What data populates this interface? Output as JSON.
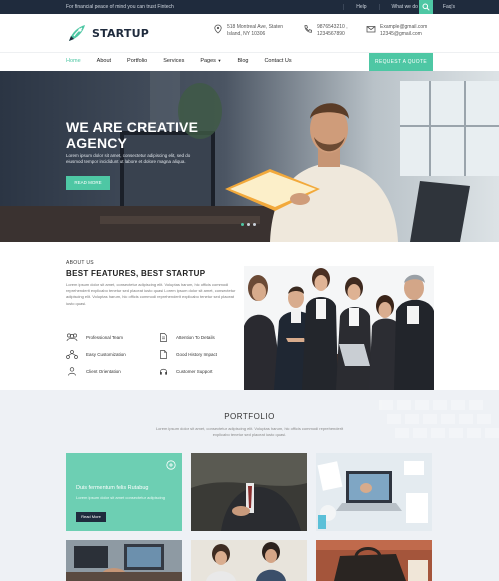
{
  "topbar": {
    "tagline": "For financial peace of mind you can trust Fintech",
    "links": [
      "Help",
      "What we do",
      "Faq's"
    ]
  },
  "brand": {
    "name": "STARTUP",
    "accent": "#4ec7a4",
    "dark": "#1f2b3d"
  },
  "contact": {
    "address_line1": "518 Montreal Ave, Staten",
    "address_line2": "Island, NY 10306",
    "phone_line1": "9876543210 ,",
    "phone_line2": "1234567890",
    "email_line1": "Example@gmail.com",
    "email_line2": "12345@gmail.com"
  },
  "nav": {
    "items": [
      "Home",
      "About",
      "Portfolio",
      "Services",
      "Pages",
      "Blog",
      "Contact Us"
    ],
    "active": "Home",
    "cta": "REQUEST A QUOTE"
  },
  "hero": {
    "title_line1": "WE ARE CREATIVE",
    "title_line2": "AGENCY",
    "text": "Lorem ipsum dolor sit amet, consectetur adipiscing elit, sed do eiusmod tempor incididunt ut labore et dolore magna aliqua.",
    "button": "READ MORE"
  },
  "features": {
    "kicker": "ABOUT US",
    "title": "BEST FEATURES, BEST STARTUP",
    "text": "Lorem ipsum dolor sit amet, consectetur adipiscing elit. Voluptas harum, hic officis commodi reprehenderit explicabo tenetur sed placeat iusto quasi Lorem ipsum dolor sit amet, consectetur adipiscing elit. Voluptas harum, hic officis commodi reprehenderit explicabo tenetur sed placeat iusto quasi.",
    "items": [
      {
        "label": "Professional Team",
        "icon": "team-icon"
      },
      {
        "label": "Attention To Details",
        "icon": "document-icon"
      },
      {
        "label": "Easy Customization",
        "icon": "customization-icon"
      },
      {
        "label": "Good History Impact",
        "icon": "file-icon"
      },
      {
        "label": "Client Orientation",
        "icon": "client-icon"
      },
      {
        "label": "Customer Support",
        "icon": "headset-icon"
      }
    ]
  },
  "portfolio": {
    "title": "PORTFOLIO",
    "text": "Lorem ipsum dolor sit amet, consectetur adipiscing elit. Voluptas harum, hic officis commodi reprehenderit explicabo tenetur sed placeat iusto quasi.",
    "featured": {
      "caption": "Duis fermentum felis Rutabug",
      "text": "Lorem ipsum dolor sit amet consectetur adipiscing",
      "button": "Read More"
    }
  }
}
